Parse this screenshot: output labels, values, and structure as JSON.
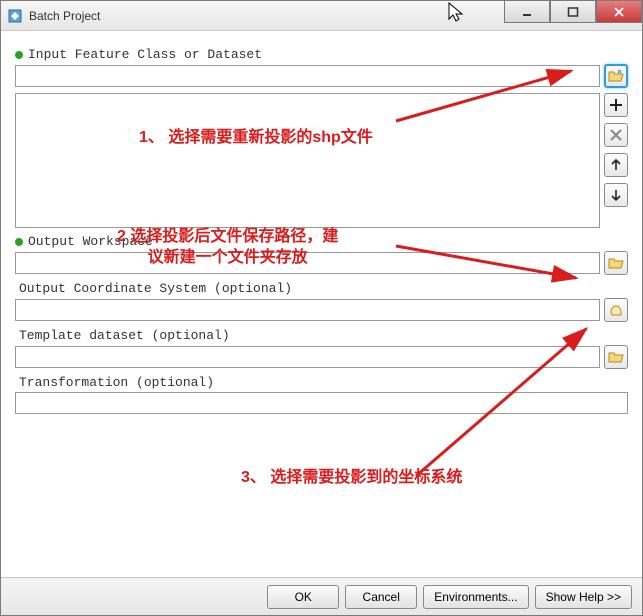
{
  "window": {
    "title": "Batch Project"
  },
  "titlebar_buttons": {
    "min": "minimize",
    "max": "maximize",
    "close": "close"
  },
  "fields": {
    "input": {
      "label": "Input Feature Class or Dataset",
      "value": "",
      "required": true
    },
    "output_workspace": {
      "label": "Output Workspace",
      "value": "",
      "required": true
    },
    "out_crs": {
      "label": "Output Coordinate System (optional)",
      "value": "",
      "required": false
    },
    "template": {
      "label": "Template dataset (optional)",
      "value": "",
      "required": false
    },
    "transformation": {
      "label": "Transformation (optional)",
      "value": "",
      "required": false
    }
  },
  "list_buttons": {
    "add": "+",
    "remove": "×",
    "up": "↑",
    "down": "↓"
  },
  "annotations": {
    "a1": "1、 选择需要重新投影的shp文件",
    "a2_l1": "2   选择投影后文件保存路径，建",
    "a2_l2": "议新建一个文件夹存放",
    "a3": "3、 选择需要投影到的坐标系统"
  },
  "buttons": {
    "ok": "OK",
    "cancel": "Cancel",
    "env": "Environments...",
    "help": "Show Help >>"
  },
  "colors": {
    "annotation_red": "#d91c1c",
    "required_dot": "#2aa12a"
  }
}
